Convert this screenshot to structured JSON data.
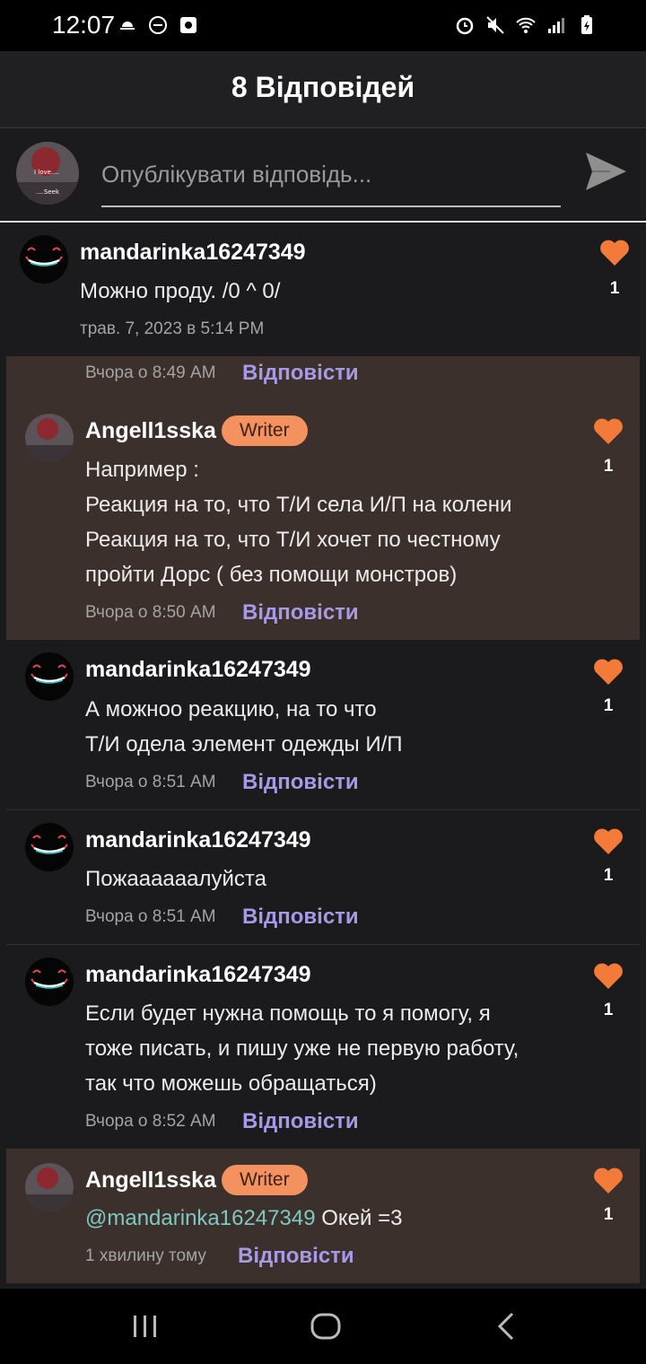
{
  "status_bar": {
    "time": "12:07",
    "left_icons": [
      "weather-icon",
      "do-not-disturb-icon",
      "screenshot-icon"
    ],
    "right_icons": [
      "alarm-icon",
      "mute-icon",
      "wifi-icon",
      "signal-icon",
      "battery-icon"
    ]
  },
  "header": {
    "title": "8 Відповідей"
  },
  "composer": {
    "placeholder": "Опублікувати відповідь...",
    "avatar_text_top": "I love....",
    "avatar_text_bottom": "....Seek"
  },
  "comments": [
    {
      "username": "mandarinka16247349",
      "lines": [
        "Можно проду.  /0 ^ 0/"
      ],
      "time": "трав. 7, 2023 в 5:14 PM",
      "reply": "",
      "likes": "1"
    },
    {
      "time": "Вчора о 8:49 AM",
      "reply": "Відповісти"
    },
    {
      "username": "Angell1sska",
      "badge": "Writer",
      "lines": [
        "Например :",
        "Реакция на то, что Т/И села И/П на колени",
        "Реакция на то, что Т/И хочет по честному",
        "пройти Дорс ( без помощи монстров)"
      ],
      "time": "Вчора о 8:50 AM",
      "reply": "Відповісти",
      "likes": "1"
    },
    {
      "username": "mandarinka16247349",
      "lines": [
        "А можноо реакцию, на то что",
        "Т/И одела элемент одежды И/П"
      ],
      "time": "Вчора о 8:51 AM",
      "reply": "Відповісти",
      "likes": "1"
    },
    {
      "username": "mandarinka16247349",
      "lines": [
        "Пожаааааалуйста"
      ],
      "time": "Вчора о 8:51 AM",
      "reply": "Відповісти",
      "likes": "1"
    },
    {
      "username": "mandarinka16247349",
      "lines": [
        "Если будет нужна помощь то я помогу, я",
        "тоже писать, и пишу уже не первую работу,",
        "так что можешь обращаться)"
      ],
      "time": "Вчора о 8:52 AM",
      "reply": "Відповісти",
      "likes": "1"
    },
    {
      "username": "Angell1sska",
      "badge": "Writer",
      "mention": "@mandarinka16247349",
      "text_after_mention": " Окей =3",
      "time": "1 хвилину тому",
      "reply": "Відповісти",
      "likes": "1"
    }
  ],
  "colors": {
    "accent_reply": "#a69ae6",
    "heart": "#f47a3a",
    "badge": "#f4925f",
    "highlight_bg": "#3c302c",
    "mention": "#7fc8c2"
  }
}
